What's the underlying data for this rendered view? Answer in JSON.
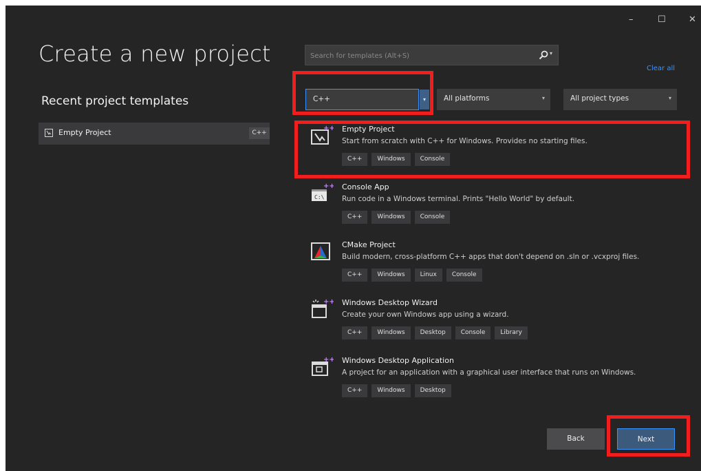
{
  "window": {
    "minimize_glyph": "–",
    "maximize_glyph": "☐",
    "close_glyph": "✕"
  },
  "left": {
    "title": "Create a new project",
    "recent_heading": "Recent project templates",
    "recent_items": [
      {
        "label": "Empty Project",
        "badge": "C++",
        "icon": "empty-project-icon"
      }
    ]
  },
  "search": {
    "placeholder": "Search for templates (Alt+S)",
    "value": "",
    "dropdown_glyph": "▾",
    "clear_all": "Clear all"
  },
  "filters": {
    "language": "C++",
    "platform": "All platforms",
    "project_type": "All project types",
    "arrow": "▾"
  },
  "templates": [
    {
      "name": "Empty Project",
      "description": "Start from scratch with C++ for Windows. Provides no starting files.",
      "tags": [
        "C++",
        "Windows",
        "Console"
      ],
      "icon": "empty-project-icon"
    },
    {
      "name": "Console App",
      "description": "Run code in a Windows terminal. Prints \"Hello World\" by default.",
      "tags": [
        "C++",
        "Windows",
        "Console"
      ],
      "icon": "console-app-icon"
    },
    {
      "name": "CMake Project",
      "description": "Build modern, cross-platform C++ apps that don't depend on .sln or .vcxproj files.",
      "tags": [
        "C++",
        "Windows",
        "Linux",
        "Console"
      ],
      "icon": "cmake-icon"
    },
    {
      "name": "Windows Desktop Wizard",
      "description": "Create your own Windows app using a wizard.",
      "tags": [
        "C++",
        "Windows",
        "Desktop",
        "Console",
        "Library"
      ],
      "icon": "wizard-icon"
    },
    {
      "name": "Windows Desktop Application",
      "description": "A project for an application with a graphical user interface that runs on Windows.",
      "tags": [
        "C++",
        "Windows",
        "Desktop"
      ],
      "icon": "desktop-app-icon"
    }
  ],
  "footer": {
    "back_label": "Back",
    "next_label": "Next"
  },
  "colors": {
    "background": "#252526",
    "accent": "#3794ff",
    "highlight": "#f21d1d"
  }
}
